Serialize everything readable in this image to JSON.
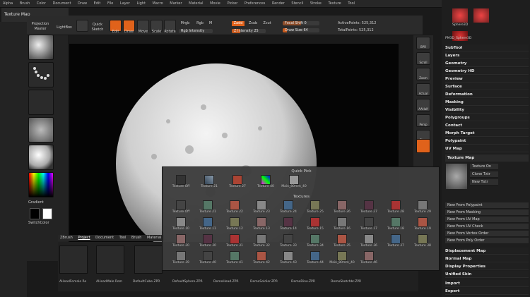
{
  "menubar": {
    "items": [
      "Alpha",
      "Brush",
      "Color",
      "Document",
      "Draw",
      "Edit",
      "File",
      "Layer",
      "Light",
      "Macro",
      "Marker",
      "Material",
      "Movie",
      "Picker",
      "Preferences",
      "Render",
      "Stencil",
      "Stroke",
      "Texture",
      "Tool",
      "Transform",
      "Zoom",
      "Zplugin",
      "Zscript"
    ]
  },
  "top_label": "Texture Map",
  "toolbar": {
    "projection_master": "Projection Master",
    "lightbox": "LightBox",
    "quick_sketch": "Quick Sketch",
    "edit": "Edit",
    "draw": "Draw",
    "move": "Move",
    "scale": "Scale",
    "rotate": "Rotate",
    "mrgb": "Mrgb",
    "rgb": "Rgb",
    "m": "M",
    "zadd": "Zadd",
    "zsub": "Zsub",
    "zcut": "Zcut",
    "rgb_intensity": "Rgb Intensity",
    "z_intensity": "Z Intensity 25",
    "focal_shift": "Focal Shift 0",
    "draw_size": "Draw Size 64",
    "active_points": "ActivePoints: 525,312",
    "total_points": "TotalPoints: 525,312"
  },
  "leftpanel": {
    "gradient": "Gradient",
    "switch_color": "SwitchColor"
  },
  "rightshelf": {
    "items": [
      "BPR",
      "Scroll",
      "Zoom",
      "Actual",
      "AAHalf",
      "Persp",
      "Floor",
      "Frame",
      "Move",
      "Scale",
      "Rotate"
    ]
  },
  "rightpanel": {
    "menus": [
      "SubTool",
      "Layers",
      "Geometry",
      "Geometry HD",
      "Preview",
      "Surface",
      "Deformation",
      "Masking",
      "Visibility",
      "Polygroups",
      "Contact",
      "Morph Target",
      "Polypaint",
      "UV Map",
      "Texture Map"
    ],
    "texture_on": "Texture On",
    "clone_txtr": "Clone Txtr",
    "new_txtr": "New Txtr",
    "sub_items": [
      "New From Polypaint",
      "New From Masking",
      "New From UV Map",
      "New From UV Check",
      "New From Vertex Order",
      "New From Poly Order"
    ],
    "menus_bottom": [
      "Displacement Map",
      "Normal Map",
      "Display Properties",
      "Unified Skin",
      "Import",
      "Export"
    ],
    "tools": [
      "Sphere3D",
      "PM3D_Sphere3D"
    ]
  },
  "popup": {
    "quick_pick_label": "Quick Pick",
    "quick_pick": [
      "Texture Off",
      "Texture 21",
      "Texture 27",
      "Texture 40",
      "Main_80mm_40"
    ],
    "textures_label": "Textures",
    "grid": [
      [
        "Texture Off",
        "Texture 21",
        "Texture 22",
        "Texture 23",
        "Texture 24",
        "Texture 25",
        "Texture 26",
        "Texture 27",
        "Texture 28",
        "Texture 29"
      ],
      [
        "Texture 10",
        "Texture 11",
        "Texture 12",
        "Texture 13",
        "Texture 14",
        "Texture 15",
        "Texture 16",
        "Texture 17",
        "Texture 18",
        "Texture 19"
      ],
      [
        "Texture 20",
        "Texture 30",
        "Texture 31",
        "Texture 32",
        "Texture 33",
        "Texture 34",
        "Texture 35",
        "Texture 36",
        "Texture 37",
        "Texture 38"
      ],
      [
        "Texture 39",
        "Texture 40",
        "Texture 41",
        "Texture 42",
        "Texture 43",
        "Texture 44",
        "Main_80mm_40",
        "Texture 46",
        "",
        ""
      ]
    ]
  },
  "bottom": {
    "tabs": [
      "ZBrush",
      "Project",
      "Document",
      "Tool",
      "Brush",
      "Material"
    ],
    "thumbs": [
      "AHeadFemale Ro",
      "AHeadMale Rom",
      "DefaultCube.ZPR",
      "DefaultSphere.ZPR",
      "DemoHead.ZPR",
      "DemoSoldier.ZPR",
      "DemoDino.ZPR",
      "DemoSketchbr.ZPR"
    ]
  }
}
